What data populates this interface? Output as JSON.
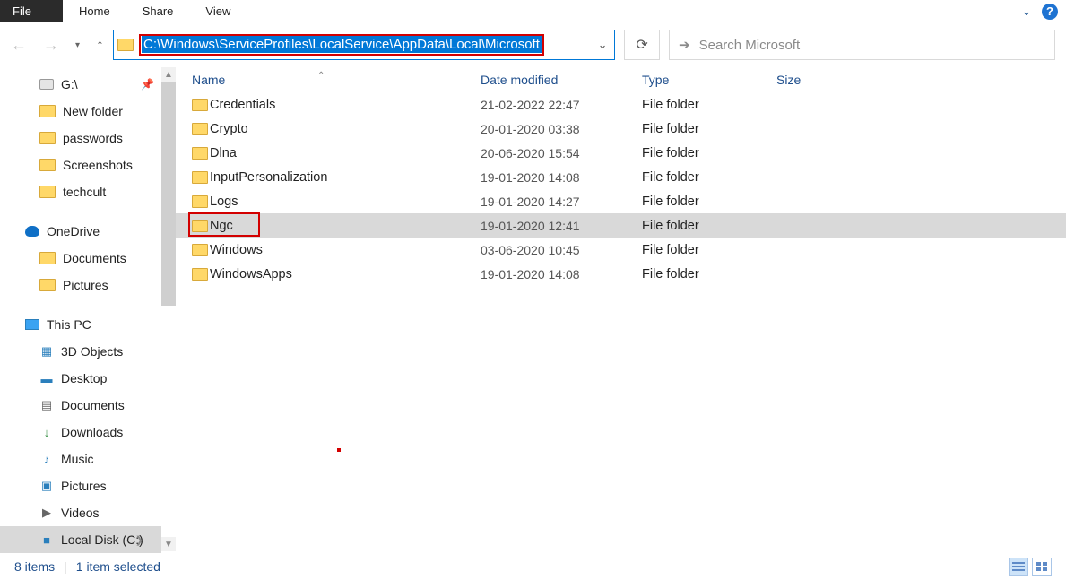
{
  "ribbon": {
    "file": "File",
    "tabs": [
      "Home",
      "Share",
      "View"
    ]
  },
  "address": {
    "path": "C:\\Windows\\ServiceProfiles\\LocalService\\AppData\\Local\\Microsoft"
  },
  "search": {
    "placeholder": "Search Microsoft"
  },
  "tree": {
    "drive_g": "G:\\",
    "quick": [
      {
        "label": "New folder"
      },
      {
        "label": "passwords"
      },
      {
        "label": "Screenshots"
      },
      {
        "label": "techcult"
      }
    ],
    "onedrive": "OneDrive",
    "od_children": [
      "Documents",
      "Pictures"
    ],
    "thispc": "This PC",
    "pc_children": [
      {
        "label": "3D Objects",
        "icon": "cube",
        "cls": "blue"
      },
      {
        "label": "Desktop",
        "icon": "desktop",
        "cls": "blue"
      },
      {
        "label": "Documents",
        "icon": "doc",
        "cls": "gray"
      },
      {
        "label": "Downloads",
        "icon": "down",
        "cls": "green"
      },
      {
        "label": "Music",
        "icon": "music",
        "cls": "blue"
      },
      {
        "label": "Pictures",
        "icon": "pic",
        "cls": "blue"
      },
      {
        "label": "Videos",
        "icon": "vid",
        "cls": "gray"
      },
      {
        "label": "Local Disk (C:)",
        "icon": "disk",
        "cls": "blue",
        "selected": true
      }
    ]
  },
  "columns": {
    "name": "Name",
    "date": "Date modified",
    "type": "Type",
    "size": "Size"
  },
  "rows": [
    {
      "name": "Credentials",
      "date": "21-02-2022 22:47",
      "type": "File folder"
    },
    {
      "name": "Crypto",
      "date": "20-01-2020 03:38",
      "type": "File folder"
    },
    {
      "name": "Dlna",
      "date": "20-06-2020 15:54",
      "type": "File folder"
    },
    {
      "name": "InputPersonalization",
      "date": "19-01-2020 14:08",
      "type": "File folder"
    },
    {
      "name": "Logs",
      "date": "19-01-2020 14:27",
      "type": "File folder"
    },
    {
      "name": "Ngc",
      "date": "19-01-2020 12:41",
      "type": "File folder",
      "selected": true,
      "boxed": true
    },
    {
      "name": "Windows",
      "date": "03-06-2020 10:45",
      "type": "File folder"
    },
    {
      "name": "WindowsApps",
      "date": "19-01-2020 14:08",
      "type": "File folder"
    }
  ],
  "status": {
    "count": "8 items",
    "selected": "1 item selected"
  }
}
